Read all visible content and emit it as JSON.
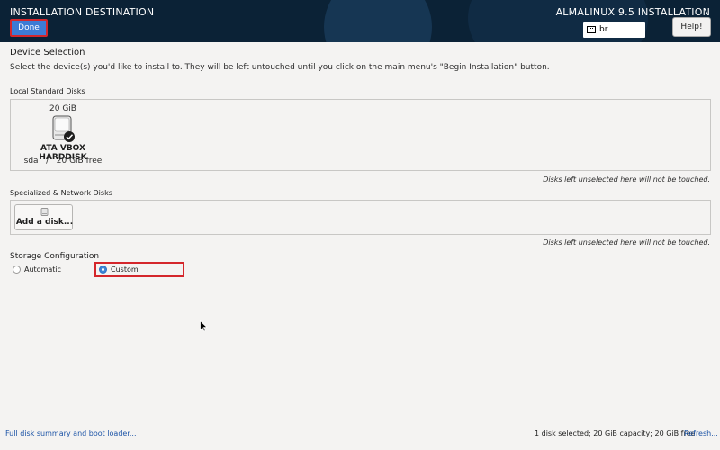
{
  "header": {
    "title": "INSTALLATION DESTINATION",
    "done_label": "Done",
    "product_title": "ALMALINUX 9.5 INSTALLATION",
    "keyboard_layout": "br",
    "help_label": "Help!"
  },
  "device_selection": {
    "title": "Device Selection",
    "description": "Select the device(s) you'd like to install to.  They will be left untouched until you click on the main menu's \"Begin Installation\" button."
  },
  "local_disks": {
    "heading": "Local Standard Disks",
    "disks": [
      {
        "size": "20 GiB",
        "name": "ATA VBOX HARDDISK",
        "info": "sda   /   20 GiB free",
        "selected": true
      }
    ],
    "note": "Disks left unselected here will not be touched."
  },
  "network_disks": {
    "heading": "Specialized & Network Disks",
    "add_label": "Add a disk...",
    "note": "Disks left unselected here will not be touched."
  },
  "storage_config": {
    "title": "Storage Configuration",
    "options": [
      {
        "label": "Automatic",
        "checked": false
      },
      {
        "label": "Custom",
        "checked": true
      }
    ]
  },
  "footer": {
    "summary_link": "Full disk summary and boot loader...",
    "status": "1 disk selected; 20 GiB capacity; 20 GiB free",
    "refresh_link": "Refresh..."
  },
  "colors": {
    "header_bg": "#0b2236",
    "accent": "#3d7bd4",
    "highlight": "#d4262b",
    "link": "#1b53a6"
  }
}
